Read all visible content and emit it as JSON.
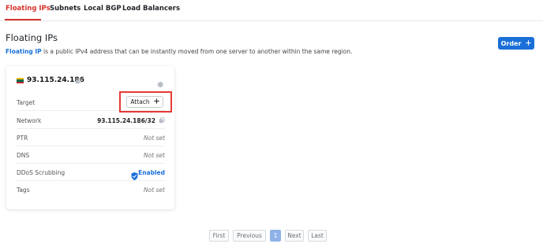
{
  "tabs": [
    {
      "label": "Floating IPs",
      "active": true
    },
    {
      "label": "Subnets",
      "active": false
    },
    {
      "label": "Local BGP",
      "active": false
    },
    {
      "label": "Load Balancers",
      "active": false
    }
  ],
  "page": {
    "title": "Floating IPs",
    "description_link": "Floating IP",
    "description_rest": " is a public IPv4 address that can be instantly moved from one server to another within the same region."
  },
  "order_button": {
    "label": "Order",
    "icon": "plus-icon",
    "color": "#1a6fd8"
  },
  "card": {
    "ip": "93.115.24.186",
    "flag_colors": [
      "#fdb913",
      "#006a44",
      "#c1272d"
    ],
    "rows": [
      {
        "label": "Target",
        "button_label": "Attach",
        "button_icon": "plus-icon"
      },
      {
        "label": "Network",
        "value": "93.115.24.186/32"
      },
      {
        "label": "PTR",
        "value": "Not set"
      },
      {
        "label": "DNS",
        "value": "Not set"
      },
      {
        "label": "DDoS Scrubbing",
        "value": "Enabled",
        "icon": "shield-check-icon"
      },
      {
        "label": "Tags",
        "value": "Not set"
      }
    ]
  },
  "pagination": {
    "first": "First",
    "previous": "Previous",
    "current": "1",
    "next": "Next",
    "last": "Last"
  },
  "colors": {
    "accent": "#1a6fd8",
    "active_tab": "#d8332c",
    "highlight": "#e53935"
  }
}
